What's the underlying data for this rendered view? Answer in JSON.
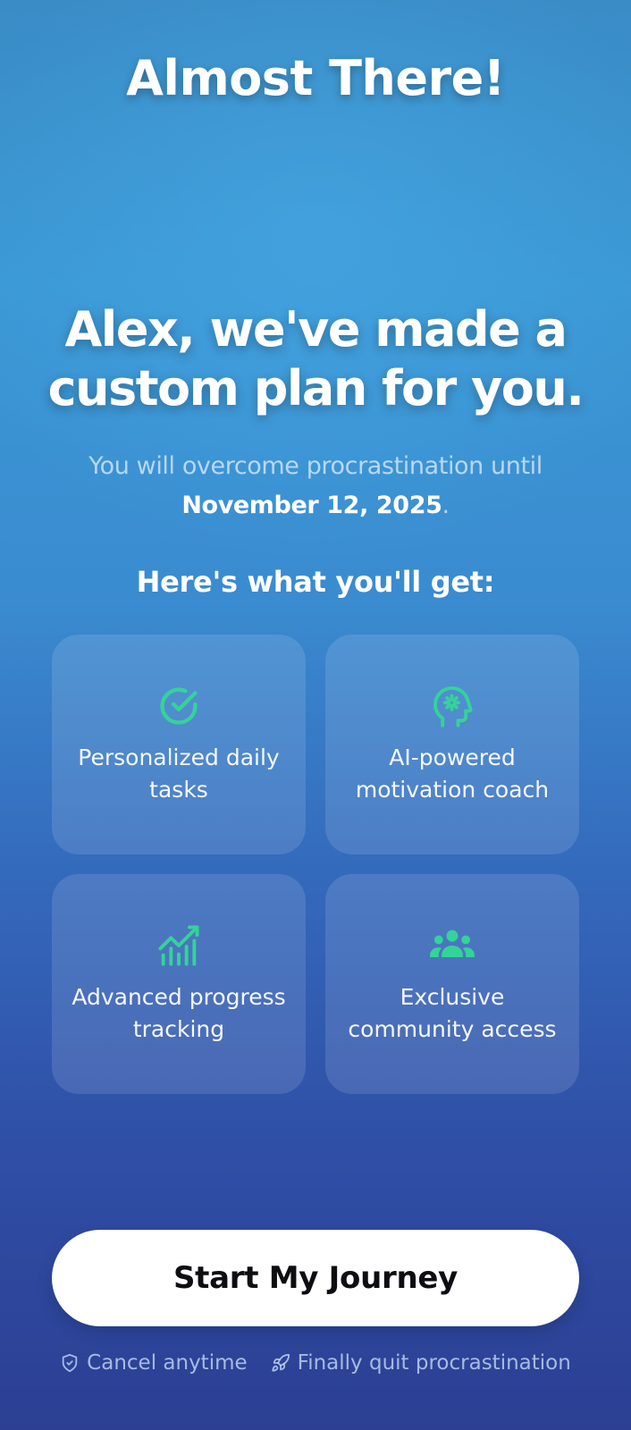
{
  "header": {
    "title": "Almost There!"
  },
  "hero": {
    "headline": "Alex, we've made a custom plan for you.",
    "subline_prefix": "You will overcome procrastination until",
    "date": "November 12, 2025",
    "subline_suffix": "."
  },
  "benefits": {
    "title": "Here's what you'll get:",
    "items": [
      {
        "label": "Personalized daily tasks",
        "icon": "check-circle-icon"
      },
      {
        "label": "AI-powered motivation coach",
        "icon": "brain-gear-head-icon"
      },
      {
        "label": "Advanced progress tracking",
        "icon": "chart-trend-icon"
      },
      {
        "label": "Exclusive community access",
        "icon": "group-users-icon"
      }
    ]
  },
  "cta": {
    "label": "Start My Journey"
  },
  "footer": {
    "cancel": "Cancel anytime",
    "quit": "Finally quit procrastination"
  },
  "colors": {
    "accent": "#34d399",
    "background_top": "#3a8cc6",
    "background_bottom": "#2c3f93"
  }
}
